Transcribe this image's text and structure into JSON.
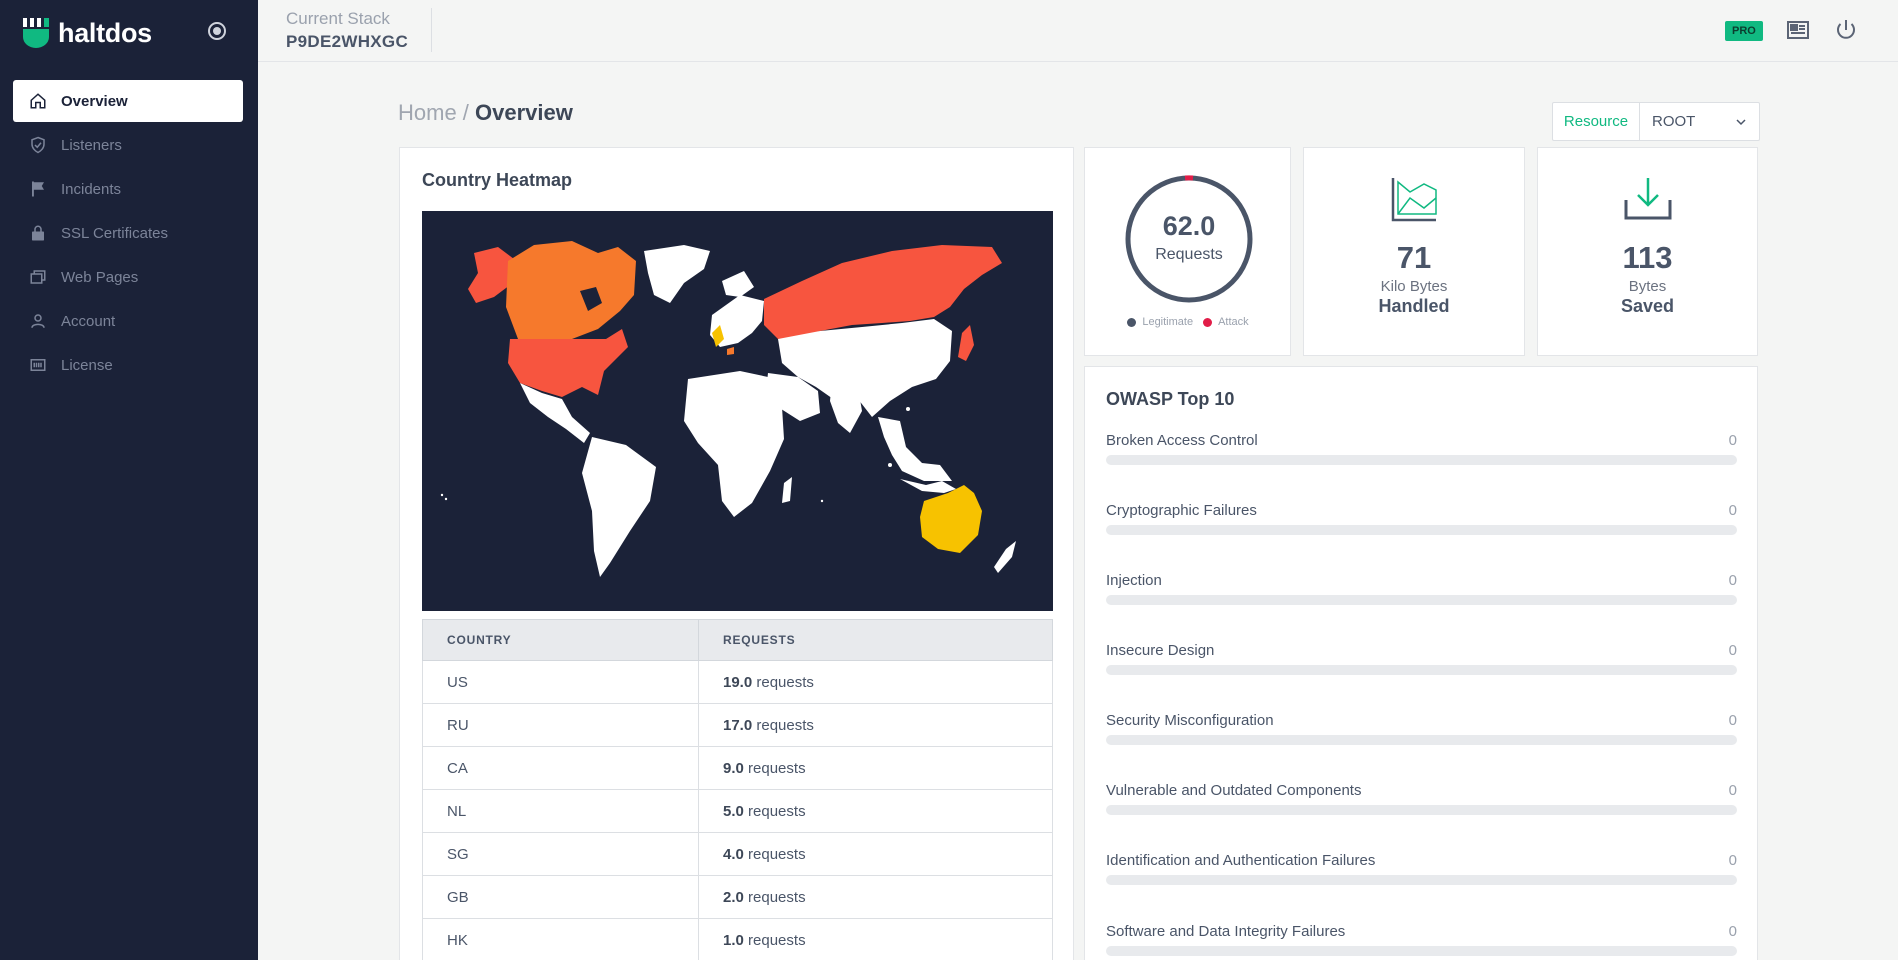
{
  "brand": {
    "name": "haltdos"
  },
  "sidebar": {
    "items": [
      {
        "label": "Overview",
        "icon": "home-icon",
        "active": true
      },
      {
        "label": "Listeners",
        "icon": "shield-icon"
      },
      {
        "label": "Incidents",
        "icon": "flag-icon"
      },
      {
        "label": "SSL Certificates",
        "icon": "lock-icon"
      },
      {
        "label": "Web Pages",
        "icon": "pages-icon"
      },
      {
        "label": "Account",
        "icon": "user-icon"
      },
      {
        "label": "License",
        "icon": "license-icon"
      }
    ]
  },
  "header": {
    "stack_label": "Current Stack",
    "stack_id": "P9DE2WHXGC",
    "badge": "PRO"
  },
  "breadcrumb": {
    "home": "Home",
    "separator": " / ",
    "current": "Overview"
  },
  "resource": {
    "button_label": "Resource",
    "selected": "ROOT"
  },
  "heatmap": {
    "title": "Country Heatmap",
    "table": {
      "headers": [
        "COUNTRY",
        "REQUESTS"
      ],
      "unit": "requests",
      "rows": [
        {
          "country": "US",
          "value": "19.0"
        },
        {
          "country": "RU",
          "value": "17.0"
        },
        {
          "country": "CA",
          "value": "9.0"
        },
        {
          "country": "NL",
          "value": "5.0"
        },
        {
          "country": "SG",
          "value": "4.0"
        },
        {
          "country": "GB",
          "value": "2.0"
        },
        {
          "country": "HK",
          "value": "1.0"
        }
      ]
    },
    "colors": {
      "high": "#f7553f",
      "mid": "#f6792c",
      "low": "#f7c200",
      "none": "#ffffff",
      "ocean": "#1b2238"
    }
  },
  "requests_card": {
    "value": "62.0",
    "label": "Requests",
    "legend": [
      {
        "label": "Legitimate",
        "color": "#4a5568"
      },
      {
        "label": "Attack",
        "color": "#e11d48"
      }
    ]
  },
  "handled_card": {
    "value": "71",
    "unit": "Kilo Bytes",
    "desc": "Handled"
  },
  "saved_card": {
    "value": "113",
    "unit": "Bytes",
    "desc": "Saved"
  },
  "owasp": {
    "title": "OWASP Top 10",
    "items": [
      {
        "name": "Broken Access Control",
        "value": "0"
      },
      {
        "name": "Cryptographic Failures",
        "value": "0"
      },
      {
        "name": "Injection",
        "value": "0"
      },
      {
        "name": "Insecure Design",
        "value": "0"
      },
      {
        "name": "Security Misconfiguration",
        "value": "0"
      },
      {
        "name": "Vulnerable and Outdated Components",
        "value": "0"
      },
      {
        "name": "Identification and Authentication Failures",
        "value": "0"
      },
      {
        "name": "Software and Data Integrity Failures",
        "value": "0"
      }
    ]
  },
  "accent": "#10b981"
}
